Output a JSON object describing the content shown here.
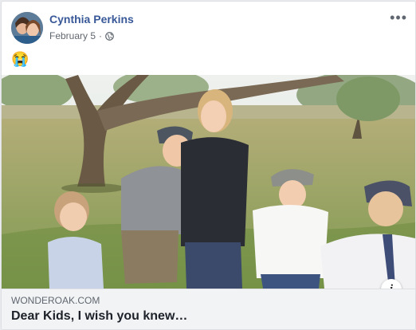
{
  "post": {
    "author": "Cynthia Perkins",
    "date": "February 5",
    "separator": "·",
    "privacy_icon": "globe-icon",
    "more_icon": "more-options-icon",
    "status_emoji": "😭"
  },
  "link": {
    "domain": "WONDEROAK.COM",
    "title": "Dear Kids, I wish you knew…",
    "info_glyph": "i"
  },
  "colors": {
    "author": "#385898",
    "link_background": "#f2f3f5"
  }
}
